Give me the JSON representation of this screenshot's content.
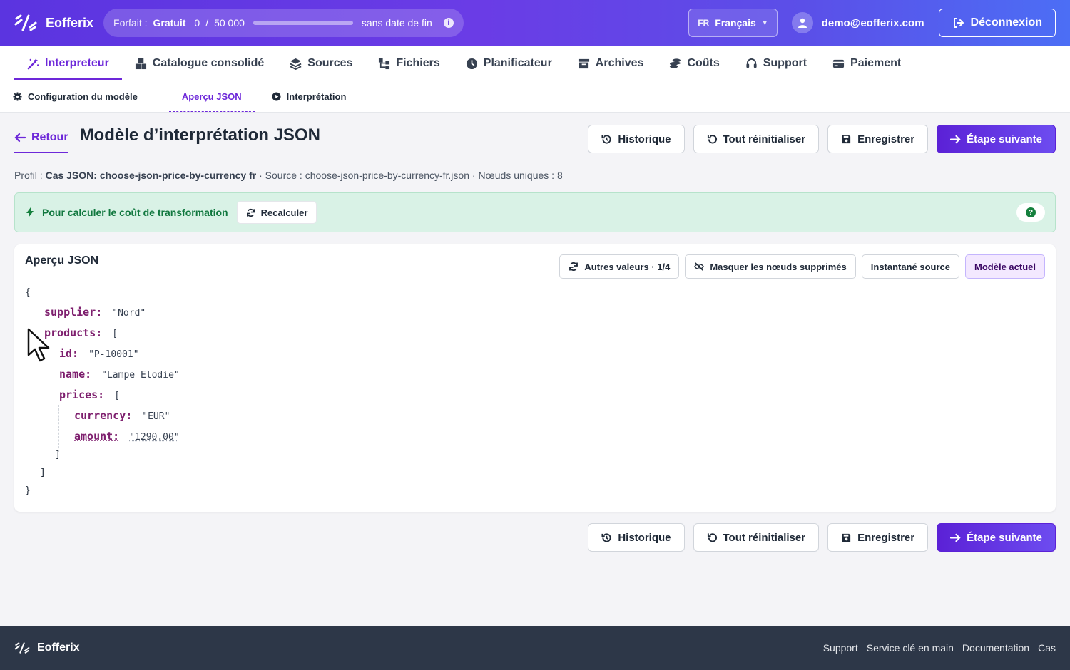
{
  "app": {
    "name": "Eofferix"
  },
  "plan": {
    "label": "Forfait :",
    "name": "Gratuit",
    "usage_current": "0",
    "usage_separator": "/",
    "usage_max": "50 000",
    "usage_fraction": 0,
    "expiry": "sans date de fin"
  },
  "language": {
    "code": "FR",
    "label": "Français"
  },
  "user": {
    "email": "demo@eofferix.com"
  },
  "logout_label": "Déconnexion",
  "main_nav": [
    {
      "label": "Interpreteur",
      "icon": "magic-wand-icon",
      "active": true
    },
    {
      "label": "Catalogue consolidé",
      "icon": "boxes-icon"
    },
    {
      "label": "Sources",
      "icon": "layers-icon"
    },
    {
      "label": "Fichiers",
      "icon": "tree-icon"
    },
    {
      "label": "Planificateur",
      "icon": "clock-icon"
    },
    {
      "label": "Archives",
      "icon": "archive-icon"
    },
    {
      "label": "Coûts",
      "icon": "coins-icon"
    },
    {
      "label": "Support",
      "icon": "headset-icon"
    },
    {
      "label": "Paiement",
      "icon": "credit-card-icon"
    }
  ],
  "sub_nav": [
    {
      "label": "Configuration du modèle",
      "icon": "gear-icon"
    },
    {
      "label": "Aperçu JSON",
      "active": true
    },
    {
      "label": "Interprétation",
      "icon": "play-icon"
    }
  ],
  "page": {
    "back_label": "Retour",
    "title": "Modèle d’interprétation JSON",
    "actions": {
      "history": "Historique",
      "reset": "Tout réinitialiser",
      "save": "Enregistrer",
      "next": "Étape suivante"
    },
    "profile": {
      "profile_label": "Profil : ",
      "profile_value": "Cas JSON: choose-json-price-by-currency fr",
      "source_label": " · Source : ",
      "source_value": "choose-json-price-by-currency-fr.json",
      "nodes_label": " · Nœuds uniques : ",
      "nodes_value": "8"
    }
  },
  "alert": {
    "text": "Pour calculer le coût de transformation",
    "button": "Recalculer",
    "help": "?"
  },
  "preview": {
    "title": "Aperçu JSON",
    "tools": {
      "other_values": "Autres valeurs · 1/4",
      "hide_deleted": "Masquer les nœuds supprimés",
      "source_snapshot": "Instantané source",
      "current_model": "Modèle actuel"
    },
    "lines": {
      "open_brace": "{",
      "supplier_key": "supplier:",
      "supplier_val": "\"Nord\"",
      "products_key": "products:",
      "products_open": "[",
      "id_key": "id:",
      "id_val": "\"P-10001\"",
      "name_key": "name:",
      "name_val": "\"Lampe Elodie\"",
      "prices_key": "prices:",
      "prices_open": "[",
      "currency_key": "currency:",
      "currency_val": "\"EUR\"",
      "amount_key": "amount:",
      "amount_val": "\"1290.00\"",
      "prices_close": "]",
      "products_close": "]",
      "close_brace": "}"
    }
  },
  "footer": {
    "links": [
      "Support",
      "Service clé en main",
      "Documentation",
      "Cas"
    ]
  }
}
